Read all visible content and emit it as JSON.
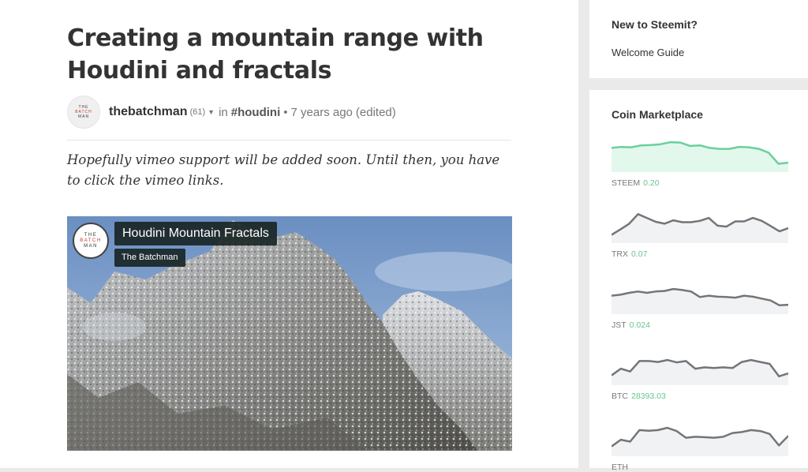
{
  "post": {
    "title": "Creating a mountain range with Houdini and fractals",
    "author": "thebatchman",
    "reputation": "(61)",
    "in_text": "in",
    "tag": "#houdini",
    "time": "7 years ago",
    "edited": "(edited)",
    "intro": "Hopefully vimeo support will be added soon. Until then, you have to click the vimeo links."
  },
  "avatar_text": [
    "THE",
    "BATCH",
    "MAN"
  ],
  "video": {
    "title": "Houdini Mountain Fractals",
    "channel": "The Batchman"
  },
  "sidebar": {
    "new_heading": "New to Steemit?",
    "welcome_link": "Welcome Guide",
    "market_heading": "Coin Marketplace",
    "coins": [
      {
        "symbol": "STEEM",
        "price": "0.20",
        "color": "#6ad09b",
        "fill": "#e3f8ec",
        "trend": [
          0.55,
          0.5,
          0.52,
          0.42,
          0.4,
          0.36,
          0.25,
          0.27,
          0.45,
          0.42,
          0.55,
          0.6,
          0.6,
          0.5,
          0.52,
          0.6,
          0.8,
          1.38,
          1.32
        ]
      },
      {
        "symbol": "TRX",
        "price": "0.07",
        "color": "#737578",
        "fill": "#f1f2f4",
        "trend": [
          1.38,
          1.1,
          0.8,
          0.3,
          0.5,
          0.7,
          0.8,
          0.62,
          0.72,
          0.72,
          0.65,
          0.5,
          0.9,
          0.95,
          0.68,
          0.68,
          0.5,
          0.65,
          0.92,
          1.2,
          1.03
        ]
      },
      {
        "symbol": "JST",
        "price": "0.024",
        "color": "#737578",
        "fill": "#f1f2f4",
        "trend": [
          0.85,
          0.8,
          0.7,
          0.63,
          0.7,
          0.63,
          0.6,
          0.5,
          0.55,
          0.63,
          0.92,
          0.85,
          0.9,
          0.92,
          0.95,
          0.85,
          0.9,
          1.0,
          1.1,
          1.35,
          1.32
        ]
      },
      {
        "symbol": "BTC",
        "price": "28393.03",
        "color": "#737578",
        "fill": "#f1f2f4",
        "trend": [
          1.3,
          0.95,
          1.1,
          0.55,
          0.55,
          0.6,
          0.5,
          0.62,
          0.55,
          0.95,
          0.88,
          0.92,
          0.88,
          0.92,
          0.6,
          0.5,
          0.6,
          0.7,
          1.35,
          1.2
        ]
      },
      {
        "symbol": "ETH",
        "price": "",
        "color": "#737578",
        "fill": "#f1f2f4",
        "trend": [
          1.3,
          0.95,
          1.05,
          0.45,
          0.48,
          0.45,
          0.33,
          0.5,
          0.85,
          0.8,
          0.82,
          0.85,
          0.8,
          0.6,
          0.55,
          0.45,
          0.5,
          0.65,
          1.25,
          0.75
        ]
      }
    ]
  }
}
